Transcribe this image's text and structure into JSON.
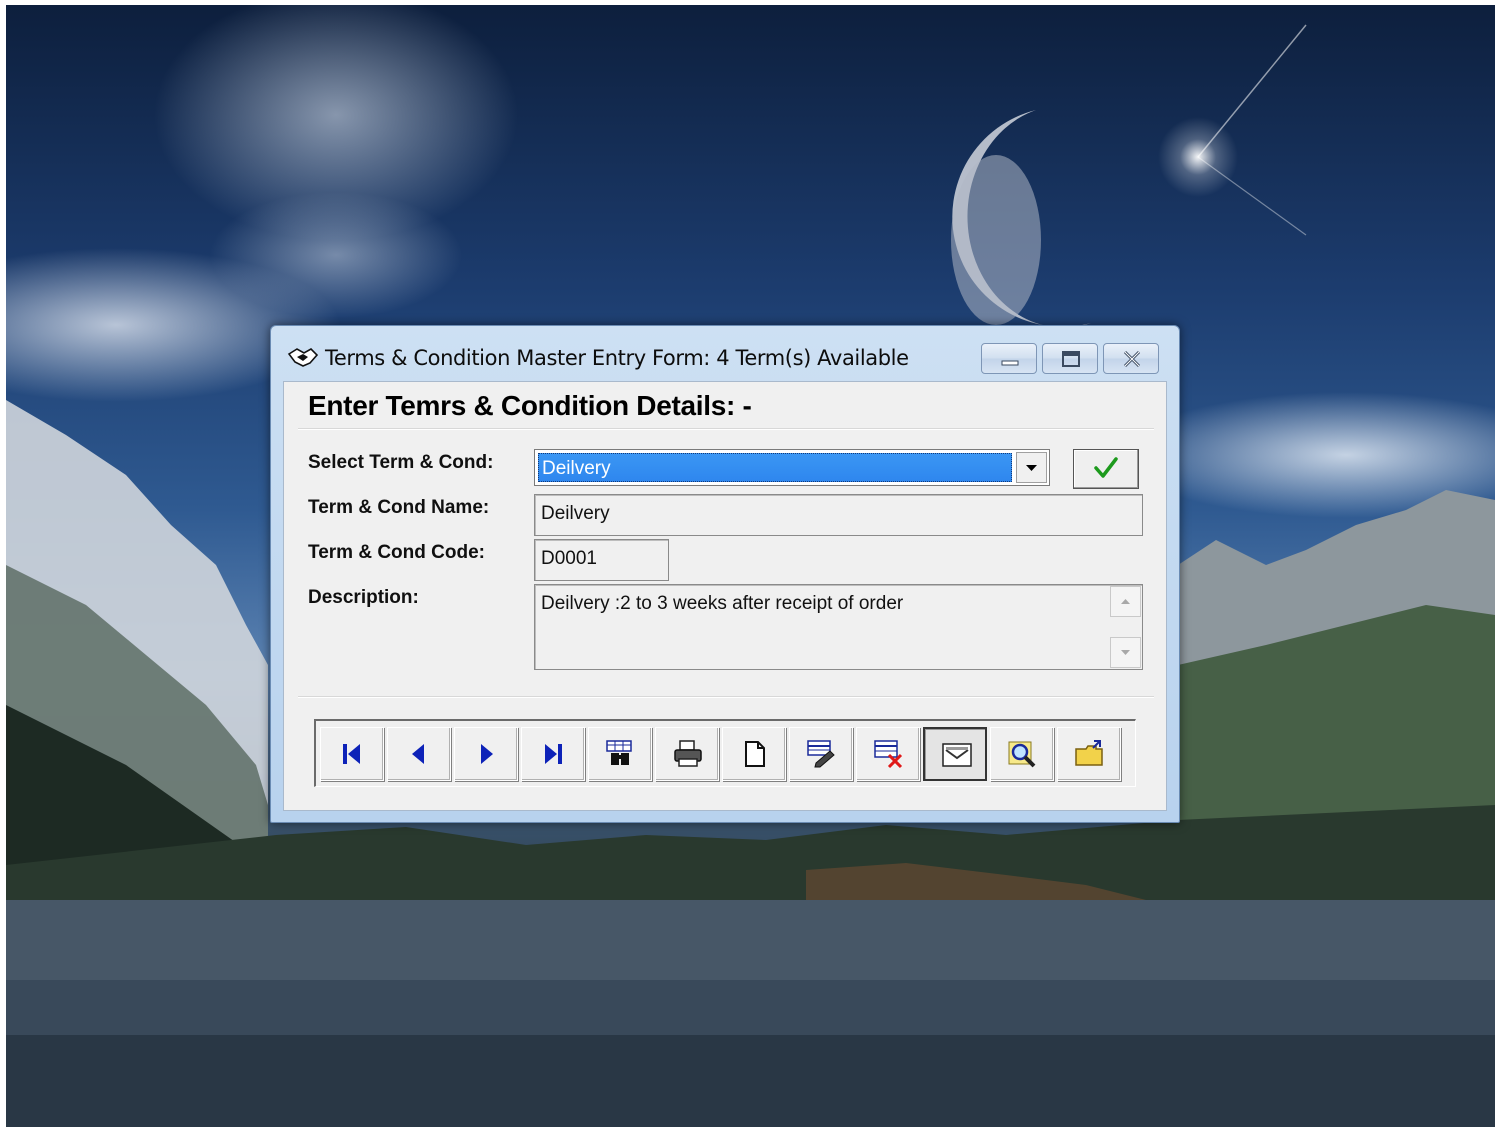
{
  "window": {
    "title": "Terms & Condition Master Entry Form: 4 Term(s) Available",
    "controls": [
      "minimize",
      "maximize",
      "close"
    ]
  },
  "form": {
    "heading": "Enter Temrs & Condition Details: -",
    "select_label": "Select Term & Cond:",
    "select_value": "Deilvery",
    "name_label": "Term & Cond Name:",
    "name_value": "Deilvery",
    "code_label": "Term & Cond Code:",
    "code_value": "D0001",
    "description_label": "Description:",
    "description_value": "Deilvery :2 to 3 weeks after receipt of order"
  },
  "toolbar": {
    "buttons": [
      {
        "icon": "first-record-icon"
      },
      {
        "icon": "previous-record-icon"
      },
      {
        "icon": "next-record-icon"
      },
      {
        "icon": "last-record-icon"
      },
      {
        "icon": "find-binoculars-icon"
      },
      {
        "icon": "print-icon"
      },
      {
        "icon": "new-document-icon"
      },
      {
        "icon": "edit-record-icon"
      },
      {
        "icon": "delete-record-icon"
      },
      {
        "icon": "save-record-icon",
        "pressed": true
      },
      {
        "icon": "search-magnifier-icon"
      },
      {
        "icon": "exit-folder-icon"
      }
    ]
  },
  "colors": {
    "selection": "#2e86ee",
    "nav_arrow": "#0d22b8",
    "check": "#1d9a1d"
  }
}
